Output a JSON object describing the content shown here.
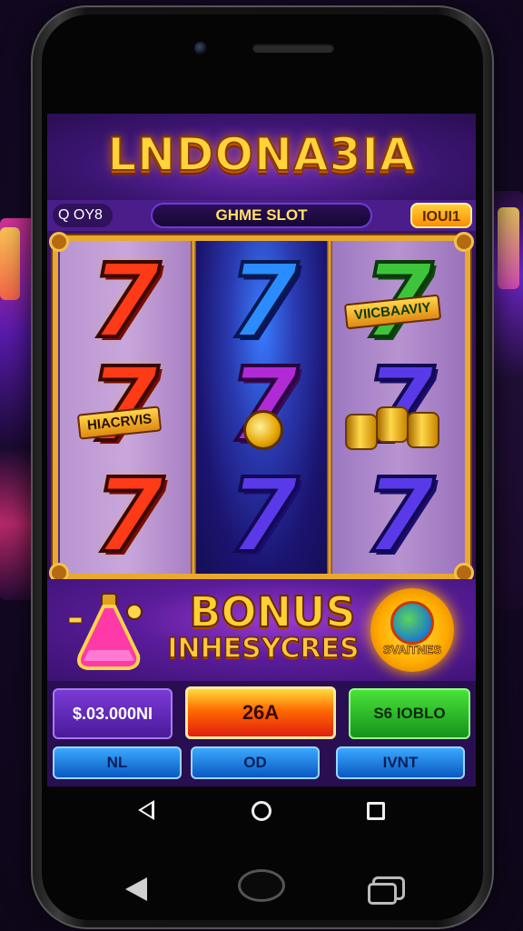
{
  "app": {
    "title": "LNDONA3IA"
  },
  "header": {
    "coin_label": "Q OY8",
    "game_label": "GHME SLOT",
    "credit_label": "IOUI1"
  },
  "reels": {
    "ribbons": {
      "r1_mid": "HIACRVIS",
      "r3_top": "VIICBAAVIY"
    },
    "symbol_glyph": "7"
  },
  "bonus": {
    "title": "BONUS",
    "subtitle": "INHESYCRES",
    "badge_text": "SVAITNES"
  },
  "controls": {
    "balance": "$.03.000NI",
    "spin": "26A",
    "win": "S6 IOBLO",
    "btn1": "NL",
    "btn2": "OD",
    "btn3": "IVNT"
  },
  "colors": {
    "accent_gold": "#ffd33a",
    "spin_red": "#e01e10",
    "win_green": "#16931a",
    "button_blue": "#0a58c0"
  }
}
